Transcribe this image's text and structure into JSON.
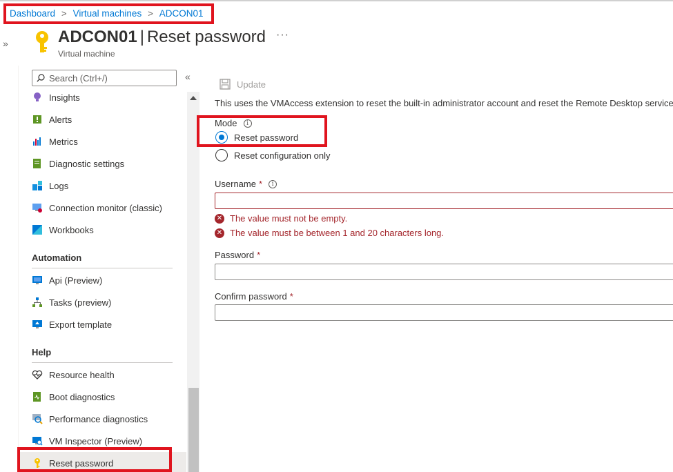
{
  "breadcrumb": {
    "items": [
      "Dashboard",
      "Virtual machines",
      "ADCON01"
    ],
    "separator": ">"
  },
  "header": {
    "resource_name": "ADCON01",
    "separator": "|",
    "page_name": "Reset password",
    "subtitle": "Virtual machine",
    "more": "···",
    "icon": "key-icon"
  },
  "rail": {
    "expand": "»"
  },
  "sidebar": {
    "search_placeholder": "Search (Ctrl+/)",
    "collapse": "«",
    "items_top": [
      {
        "label": "Insights",
        "icon": "insights-icon"
      },
      {
        "label": "Alerts",
        "icon": "alerts-icon"
      },
      {
        "label": "Metrics",
        "icon": "metrics-icon"
      },
      {
        "label": "Diagnostic settings",
        "icon": "diagnostic-settings-icon"
      },
      {
        "label": "Logs",
        "icon": "logs-icon"
      },
      {
        "label": "Connection monitor (classic)",
        "icon": "connection-monitor-icon"
      },
      {
        "label": "Workbooks",
        "icon": "workbooks-icon"
      }
    ],
    "automation": {
      "title": "Automation",
      "items": [
        {
          "label": "Api (Preview)",
          "icon": "api-icon"
        },
        {
          "label": "Tasks (preview)",
          "icon": "tasks-icon"
        },
        {
          "label": "Export template",
          "icon": "export-template-icon"
        }
      ]
    },
    "help": {
      "title": "Help",
      "items": [
        {
          "label": "Resource health",
          "icon": "heart-icon"
        },
        {
          "label": "Boot diagnostics",
          "icon": "boot-diagnostics-icon"
        },
        {
          "label": "Performance diagnostics",
          "icon": "performance-diagnostics-icon"
        },
        {
          "label": "VM Inspector (Preview)",
          "icon": "vm-inspector-icon"
        },
        {
          "label": "Reset password",
          "icon": "key-icon",
          "selected": true
        }
      ]
    }
  },
  "main": {
    "update_label": "Update",
    "description": "This uses the VMAccess extension to reset the built-in administrator account and reset the Remote Desktop service c",
    "mode": {
      "label": "Mode",
      "info": "i",
      "options": [
        {
          "label": "Reset password",
          "checked": true
        },
        {
          "label": "Reset configuration only",
          "checked": false
        }
      ]
    },
    "username": {
      "label": "Username",
      "required": "*",
      "info": "i",
      "value": "",
      "errors": [
        "The value must not be empty.",
        "The value must be between 1 and 20 characters long."
      ]
    },
    "password": {
      "label": "Password",
      "required": "*",
      "value": ""
    },
    "confirm_password": {
      "label": "Confirm password",
      "required": "*",
      "value": ""
    }
  },
  "colors": {
    "link": "#0078d4",
    "highlight_box": "#e0141e",
    "error": "#a4262c",
    "selected_bg": "#edebe9"
  }
}
